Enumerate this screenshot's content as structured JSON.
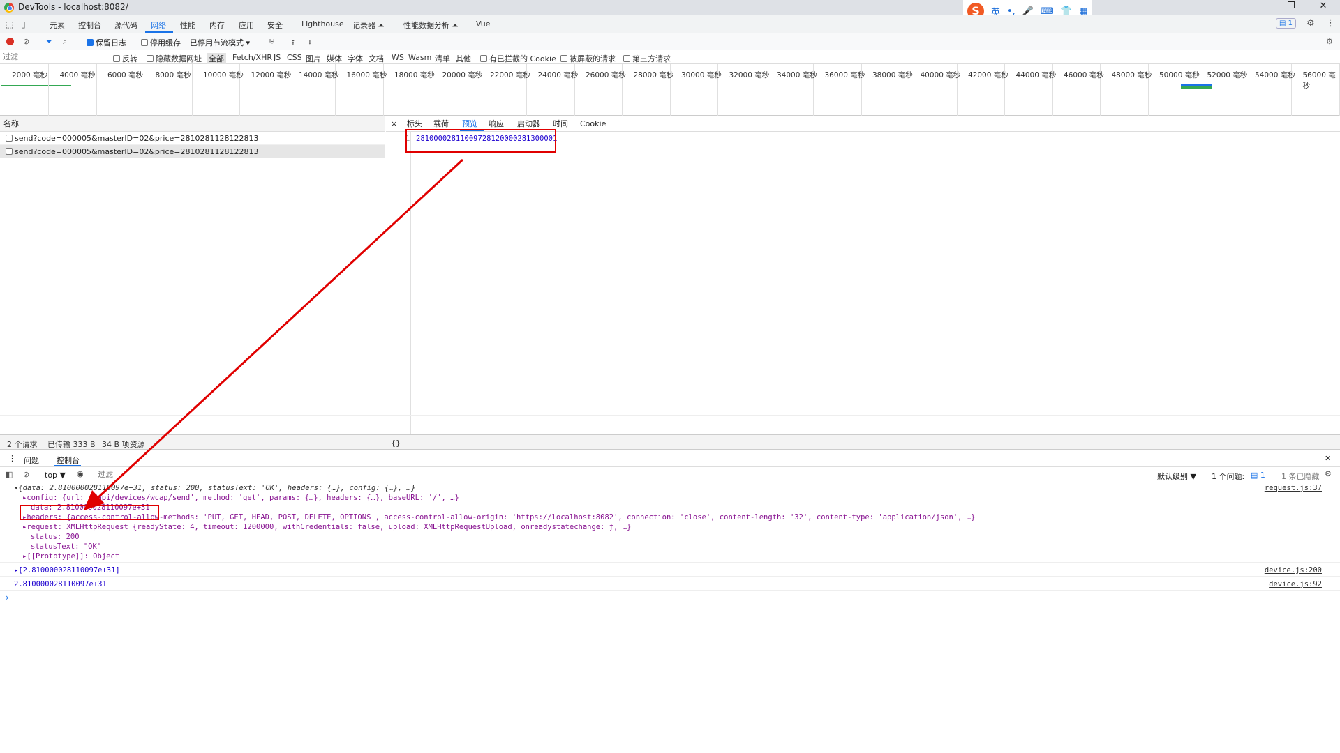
{
  "window": {
    "title": "DevTools - localhost:8082/",
    "minimize": "—",
    "restore": "❐",
    "close": "✕"
  },
  "ime": {
    "logo": "S",
    "lang": "英",
    "punct": "•,",
    "mic": "🎤",
    "keyboard": "⌨",
    "skin": "👕",
    "apps": "▦"
  },
  "main_tabs": [
    "元素",
    "控制台",
    "源代码",
    "网络",
    "性能",
    "内存",
    "应用",
    "安全",
    "Lighthouse",
    "记录器 ⏶",
    "性能数据分析 ⏶",
    "Vue"
  ],
  "issues_badge": "1",
  "toolbar": {
    "preserve_log": "保留日志",
    "disable_cache": "停用缓存",
    "throttle": "已停用节流模式"
  },
  "filter": {
    "placeholder": "过滤",
    "invert": "反转",
    "hide_data_urls": "隐藏数据网址",
    "types": [
      "全部",
      "Fetch/XHR",
      "JS",
      "CSS",
      "图片",
      "媒体",
      "字体",
      "文档",
      "WS",
      "Wasm",
      "清单",
      "其他"
    ],
    "blocked_cookies": "有已拦截的 Cookie",
    "blocked_requests": "被屏蔽的请求",
    "third_party": "第三方请求"
  },
  "timeline_ticks": [
    "2000 毫秒",
    "4000 毫秒",
    "6000 毫秒",
    "8000 毫秒",
    "10000 毫秒",
    "12000 毫秒",
    "14000 毫秒",
    "16000 毫秒",
    "18000 毫秒",
    "20000 毫秒",
    "22000 毫秒",
    "24000 毫秒",
    "26000 毫秒",
    "28000 毫秒",
    "30000 毫秒",
    "32000 毫秒",
    "34000 毫秒",
    "36000 毫秒",
    "38000 毫秒",
    "40000 毫秒",
    "42000 毫秒",
    "44000 毫秒",
    "46000 毫秒",
    "48000 毫秒",
    "50000 毫秒",
    "52000 毫秒",
    "54000 毫秒",
    "56000 毫秒"
  ],
  "list": {
    "header": "名称",
    "requests": [
      "send?code=000005&masterID=02&price=2810281128122813",
      "send?code=000005&masterID=02&price=2810281128122813"
    ]
  },
  "detail": {
    "close": "×",
    "tabs": [
      "标头",
      "载荷",
      "预览",
      "响应",
      "启动器",
      "时间",
      "Cookie"
    ],
    "line_no": "1",
    "response": "28100002811009728120000281300001",
    "format": "{}"
  },
  "status": {
    "requests": "2 个请求",
    "transferred": "已传输 333 B",
    "resources": "34 B 项资源"
  },
  "drawer": {
    "tabs": [
      "问题",
      "控制台"
    ],
    "close": "✕"
  },
  "console_toolbar": {
    "context": "top ▼",
    "filter_placeholder": "过滤",
    "level": "默认级别 ▼",
    "issues": "1 个问题:",
    "issues_count": "1",
    "hidden": "1 条已隐藏"
  },
  "console_lines": [
    {
      "text": "▾{data: 2.810000028110097e+31, status: 200, statusText: 'OK', headers: {…}, config: {…}, …}",
      "src": "request.js:37",
      "indent": 0
    },
    {
      "text": "▸config: {url: '/api/devices/wcap/send', method: 'get', params: {…}, headers: {…}, baseURL: '/', …}",
      "indent": 1
    },
    {
      "text": "data: 2.810000028110097e+31",
      "indent": 2
    },
    {
      "text": "▸headers: {access-control-allow-methods: 'PUT, GET, HEAD, POST, DELETE, OPTIONS', access-control-allow-origin: 'https://localhost:8082', connection: 'close', content-length: '32', content-type: 'application/json', …}",
      "indent": 1
    },
    {
      "text": "▸request: XMLHttpRequest {readyState: 4, timeout: 1200000, withCredentials: false, upload: XMLHttpRequestUpload, onreadystatechange: ƒ, …}",
      "indent": 1
    },
    {
      "text": "status: 200",
      "indent": 2
    },
    {
      "text": "statusText: \"OK\"",
      "indent": 2
    },
    {
      "text": "▸[[Prototype]]: Object",
      "indent": 1
    },
    {
      "text": "▸[2.810000028110097e+31]",
      "src": "device.js:200",
      "indent": 0
    },
    {
      "text": "2.810000028110097e+31",
      "src": "device.js:92",
      "indent": 0
    }
  ],
  "prompt": "›",
  "colors": {
    "accent": "#1a73e8",
    "annotation": "#e00000"
  }
}
